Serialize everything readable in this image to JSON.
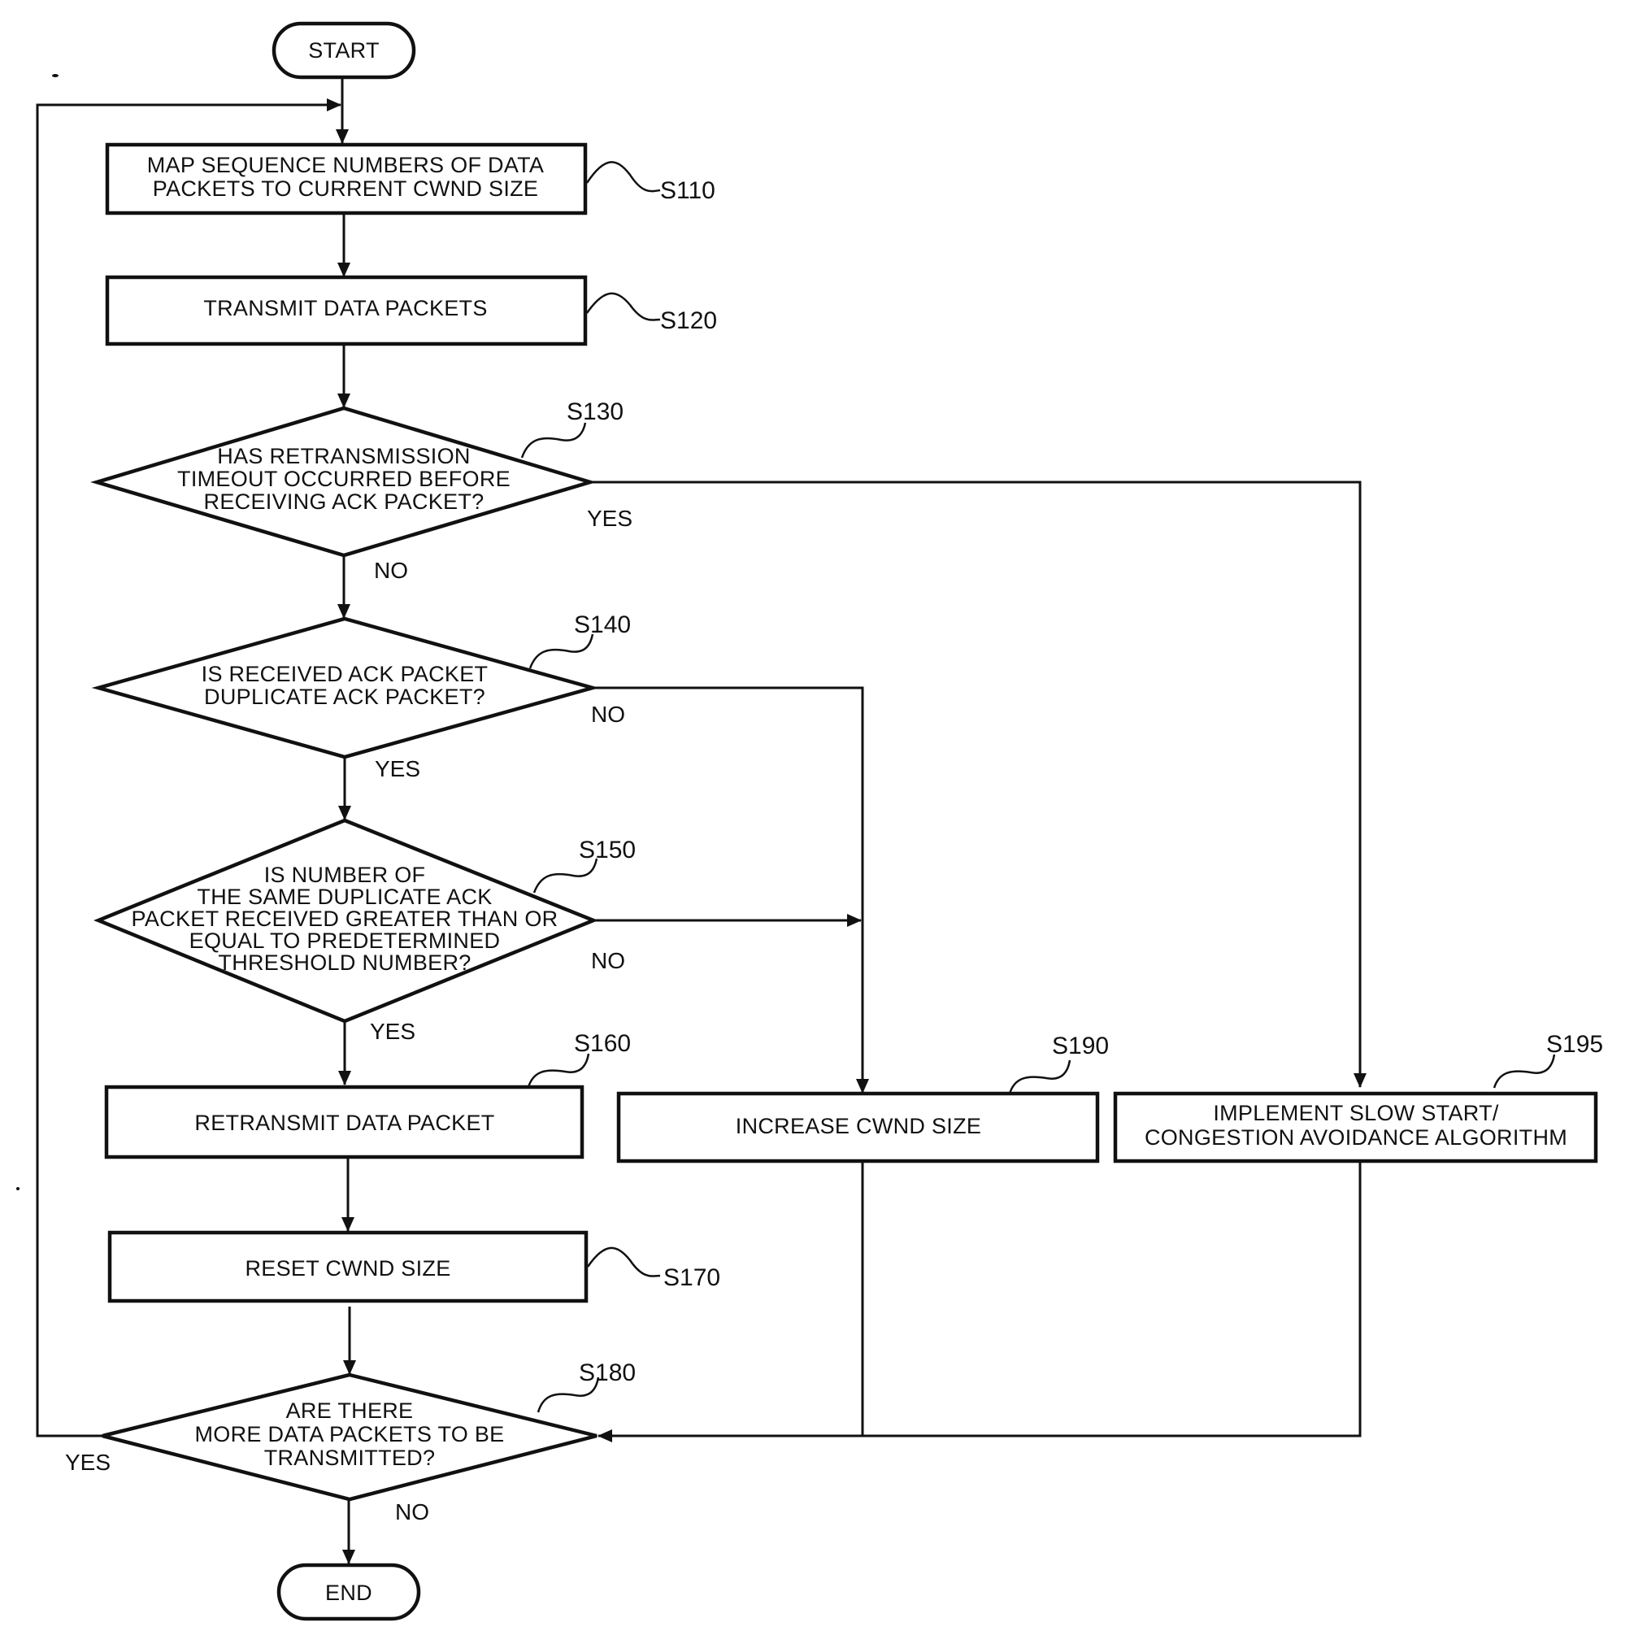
{
  "diagram": {
    "type": "flowchart",
    "terminals": {
      "start": "START",
      "end": "END"
    },
    "nodes": [
      {
        "id": "S110",
        "kind": "process",
        "lines": [
          "MAP SEQUENCE NUMBERS OF DATA",
          "PACKETS TO CURRENT CWND SIZE"
        ]
      },
      {
        "id": "S120",
        "kind": "process",
        "lines": [
          "TRANSMIT DATA PACKETS"
        ]
      },
      {
        "id": "S130",
        "kind": "decision",
        "lines": [
          "HAS RETRANSMISSION",
          "TIMEOUT OCCURRED BEFORE",
          "RECEIVING ACK PACKET?"
        ]
      },
      {
        "id": "S140",
        "kind": "decision",
        "lines": [
          "IS RECEIVED ACK PACKET",
          "DUPLICATE ACK PACKET?"
        ]
      },
      {
        "id": "S150",
        "kind": "decision",
        "lines": [
          "IS NUMBER OF",
          "THE SAME DUPLICATE ACK",
          "PACKET RECEIVED GREATER THAN OR",
          "EQUAL TO PREDETERMINED",
          "THRESHOLD NUMBER?"
        ]
      },
      {
        "id": "S160",
        "kind": "process",
        "lines": [
          "RETRANSMIT DATA PACKET"
        ]
      },
      {
        "id": "S170",
        "kind": "process",
        "lines": [
          "RESET CWND SIZE"
        ]
      },
      {
        "id": "S180",
        "kind": "decision",
        "lines": [
          "ARE THERE",
          "MORE DATA PACKETS TO BE",
          "TRANSMITTED?"
        ]
      },
      {
        "id": "S190",
        "kind": "process",
        "lines": [
          "INCREASE CWND SIZE"
        ]
      },
      {
        "id": "S195",
        "kind": "process",
        "lines": [
          "IMPLEMENT SLOW START/",
          "CONGESTION AVOIDANCE ALGORITHM"
        ]
      }
    ],
    "branch_labels": {
      "s130_yes": "YES",
      "s130_no": "NO",
      "s140_no": "NO",
      "s140_yes": "YES",
      "s150_no": "NO",
      "s150_yes": "YES",
      "s180_yes": "YES",
      "s180_no": "NO"
    },
    "edges": [
      {
        "from": "START",
        "to": "S110"
      },
      {
        "from": "S110",
        "to": "S120"
      },
      {
        "from": "S120",
        "to": "S130"
      },
      {
        "from": "S130",
        "to": "S195",
        "label": "YES"
      },
      {
        "from": "S130",
        "to": "S140",
        "label": "NO"
      },
      {
        "from": "S140",
        "to": "S190",
        "label": "NO"
      },
      {
        "from": "S140",
        "to": "S150",
        "label": "YES"
      },
      {
        "from": "S150",
        "to": "S190",
        "label": "NO"
      },
      {
        "from": "S150",
        "to": "S160",
        "label": "YES"
      },
      {
        "from": "S160",
        "to": "S170"
      },
      {
        "from": "S170",
        "to": "S180"
      },
      {
        "from": "S190",
        "to": "S180"
      },
      {
        "from": "S195",
        "to": "S180"
      },
      {
        "from": "S180",
        "to": "S110",
        "label": "YES"
      },
      {
        "from": "S180",
        "to": "END",
        "label": "NO"
      }
    ]
  }
}
